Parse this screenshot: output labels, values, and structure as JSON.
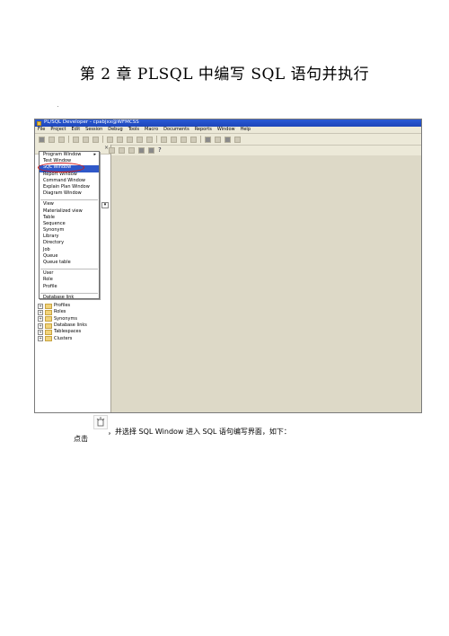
{
  "heading": "第 2 章   PLSQL 中编写 SQL 语句并执行",
  "screenshot": {
    "window_title": "PL/SQL Developer - cpabjxx@WFMCSS",
    "menu": [
      "File",
      "Project",
      "Edit",
      "Session",
      "Debug",
      "Tools",
      "Macro",
      "Documents",
      "Reports",
      "Window",
      "Help"
    ],
    "dropdown_items": [
      {
        "label": "Program Window",
        "submenu": true
      },
      {
        "label": "Test Window"
      },
      {
        "label": "SQL Window",
        "selected": true
      },
      {
        "label": "Report Window"
      },
      {
        "label": "Command Window"
      },
      {
        "label": "Explain Plan Window"
      },
      {
        "label": "Diagram Window"
      },
      {
        "sep": true
      },
      {
        "label": "View"
      },
      {
        "label": "Materialized view"
      },
      {
        "label": "Table"
      },
      {
        "label": "Sequence"
      },
      {
        "label": "Synonym"
      },
      {
        "label": "Library"
      },
      {
        "label": "Directory"
      },
      {
        "label": "Job"
      },
      {
        "label": "Queue"
      },
      {
        "label": "Queue table"
      },
      {
        "sep": true
      },
      {
        "label": "User"
      },
      {
        "label": "Role"
      },
      {
        "label": "Profile"
      },
      {
        "sep": true
      },
      {
        "label": "Database link"
      }
    ],
    "tree_items": [
      "Profiles",
      "Roles",
      "Synonyms",
      "Database links",
      "Tablespaces",
      "Clusters"
    ],
    "selected_color": "#2f58c8",
    "highlight_circle_color": "#d01a1a"
  },
  "caption": {
    "prefix": "点击",
    "text": "，并选择 SQL  Window 进入 SQL 语句编写界面，如下："
  }
}
